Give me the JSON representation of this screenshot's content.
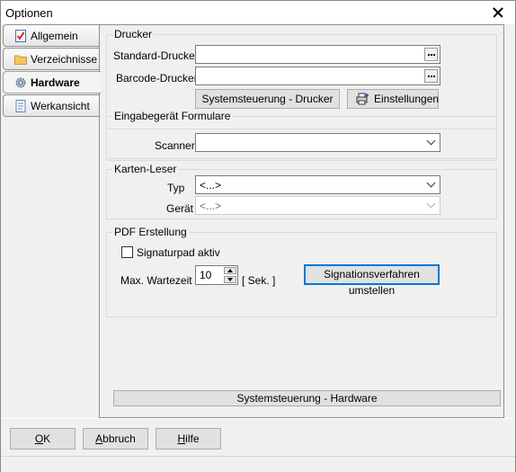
{
  "window": {
    "title": "Optionen"
  },
  "tabs": [
    {
      "label": "Allgemein",
      "icon": "checklist-icon"
    },
    {
      "label": "Verzeichnisse",
      "icon": "folder-icon"
    },
    {
      "label": "Hardware",
      "icon": "gear-icon",
      "active": true
    },
    {
      "label": "Werkansicht",
      "icon": "document-icon"
    }
  ],
  "drucker": {
    "title": "Drucker",
    "standard_label": "Standard-Drucker",
    "standard_value": "",
    "barcode_label": "Barcode-Drucker",
    "barcode_value": "",
    "systemsteuerung_btn": "Systemsteuerung - Drucker",
    "einstellungen_btn": "Einstellungen"
  },
  "eingabe": {
    "title": "Eingabegerät Formulare",
    "scanner_label": "Scanner",
    "scanner_value": ""
  },
  "karten": {
    "title": "Karten-Leser",
    "typ_label": "Typ",
    "typ_value": "<...>",
    "geraet_label": "Gerät",
    "geraet_value": "<...>"
  },
  "pdf": {
    "title": "PDF Erstellung",
    "signaturpad_label": "Signaturpad aktiv",
    "signaturpad_checked": false,
    "wartezeit_label": "Max. Wartezeit",
    "wartezeit_value": "10",
    "wartezeit_unit": "[ Sek. ]",
    "signations_btn": "Signationsverfahren umstellen"
  },
  "systemsteuerung_hardware_btn": "Systemsteuerung - Hardware",
  "footer": {
    "ok_mnemonic": "O",
    "ok_rest": "K",
    "abbruch_mnemonic": "A",
    "abbruch_rest": "bbruch",
    "hilfe_mnemonic": "H",
    "hilfe_rest": "ilfe"
  }
}
